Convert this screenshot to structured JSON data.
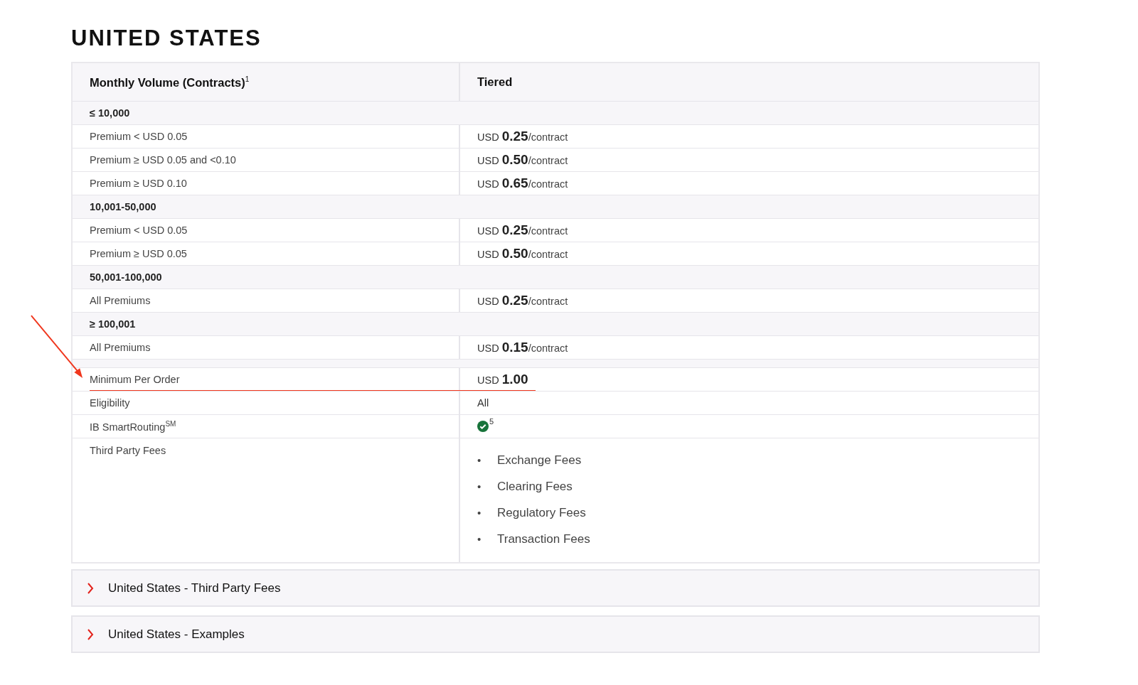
{
  "heading": "UNITED STATES",
  "table": {
    "columns": [
      {
        "label": "Monthly Volume (Contracts)$^{1}$"
      },
      {
        "label": "Tiered"
      }
    ],
    "rows": [
      {
        "kind": "group",
        "label": "≤ 10,000"
      },
      {
        "kind": "price",
        "label": "Premium < USD 0.05",
        "currency": "USD",
        "amount": "0.25",
        "unit": "/contract"
      },
      {
        "kind": "price",
        "label": "Premium ≥ USD 0.05 and <0.10",
        "currency": "USD",
        "amount": "0.50",
        "unit": "/contract"
      },
      {
        "kind": "price",
        "label": "Premium ≥ USD 0.10",
        "currency": "USD",
        "amount": "0.65",
        "unit": "/contract"
      },
      {
        "kind": "group",
        "label": "10,001-50,000"
      },
      {
        "kind": "price",
        "label": "Premium < USD 0.05",
        "currency": "USD",
        "amount": "0.25",
        "unit": "/contract"
      },
      {
        "kind": "price",
        "label": "Premium ≥ USD 0.05",
        "currency": "USD",
        "amount": "0.50",
        "unit": "/contract"
      },
      {
        "kind": "group",
        "label": "50,001-100,000"
      },
      {
        "kind": "price",
        "label": "All Premiums",
        "currency": "USD",
        "amount": "0.25",
        "unit": "/contract"
      },
      {
        "kind": "group",
        "label": "≥ 100,001"
      },
      {
        "kind": "price",
        "label": "All Premiums",
        "currency": "USD",
        "amount": "0.15",
        "unit": "/contract"
      },
      {
        "kind": "spacer"
      },
      {
        "kind": "price",
        "label": "Minimum Per Order",
        "currency": "USD",
        "amount": "1.00",
        "highlighted": true
      },
      {
        "kind": "text",
        "label": "Eligibility",
        "value": "All"
      },
      {
        "kind": "check",
        "label": "IB SmartRouting$^{SM}$",
        "note": "5"
      },
      {
        "kind": "list",
        "label": "Third Party Fees",
        "items": [
          {
            "bullet": "•",
            "text": "Exchange Fees"
          },
          {
            "bullet": "•",
            "text": "Clearing Fees"
          },
          {
            "bullet": "•",
            "text": "Regulatory Fees"
          },
          {
            "bullet": "•",
            "text": "Transaction Fees"
          }
        ]
      }
    ]
  },
  "accordions": [
    {
      "title": "United States - Third Party Fees",
      "expanded": false
    },
    {
      "title": "United States - Examples",
      "expanded": false
    }
  ]
}
